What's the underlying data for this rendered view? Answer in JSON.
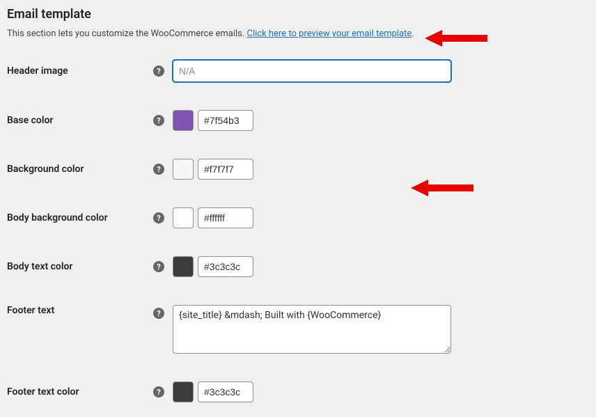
{
  "section": {
    "title": "Email template",
    "description_prefix": "This section lets you customize the WooCommerce emails. ",
    "preview_link": "Click here to preview your email template",
    "description_suffix": "."
  },
  "fields": {
    "header_image": {
      "label": "Header image",
      "placeholder": "N/A",
      "value": ""
    },
    "base_color": {
      "label": "Base color",
      "value": "#7f54b3",
      "swatch": "#7f54b3"
    },
    "background_color": {
      "label": "Background color",
      "value": "#f7f7f7",
      "swatch": "#f7f7f7"
    },
    "body_background_color": {
      "label": "Body background color",
      "value": "#ffffff",
      "swatch": "#ffffff"
    },
    "body_text_color": {
      "label": "Body text color",
      "value": "#3c3c3c",
      "swatch": "#3c3c3c"
    },
    "footer_text": {
      "label": "Footer text",
      "value": "{site_title} &mdash; Built with {WooCommerce}"
    },
    "footer_text_color": {
      "label": "Footer text color",
      "value": "#3c3c3c",
      "swatch": "#3c3c3c"
    }
  },
  "help_icon": "?"
}
